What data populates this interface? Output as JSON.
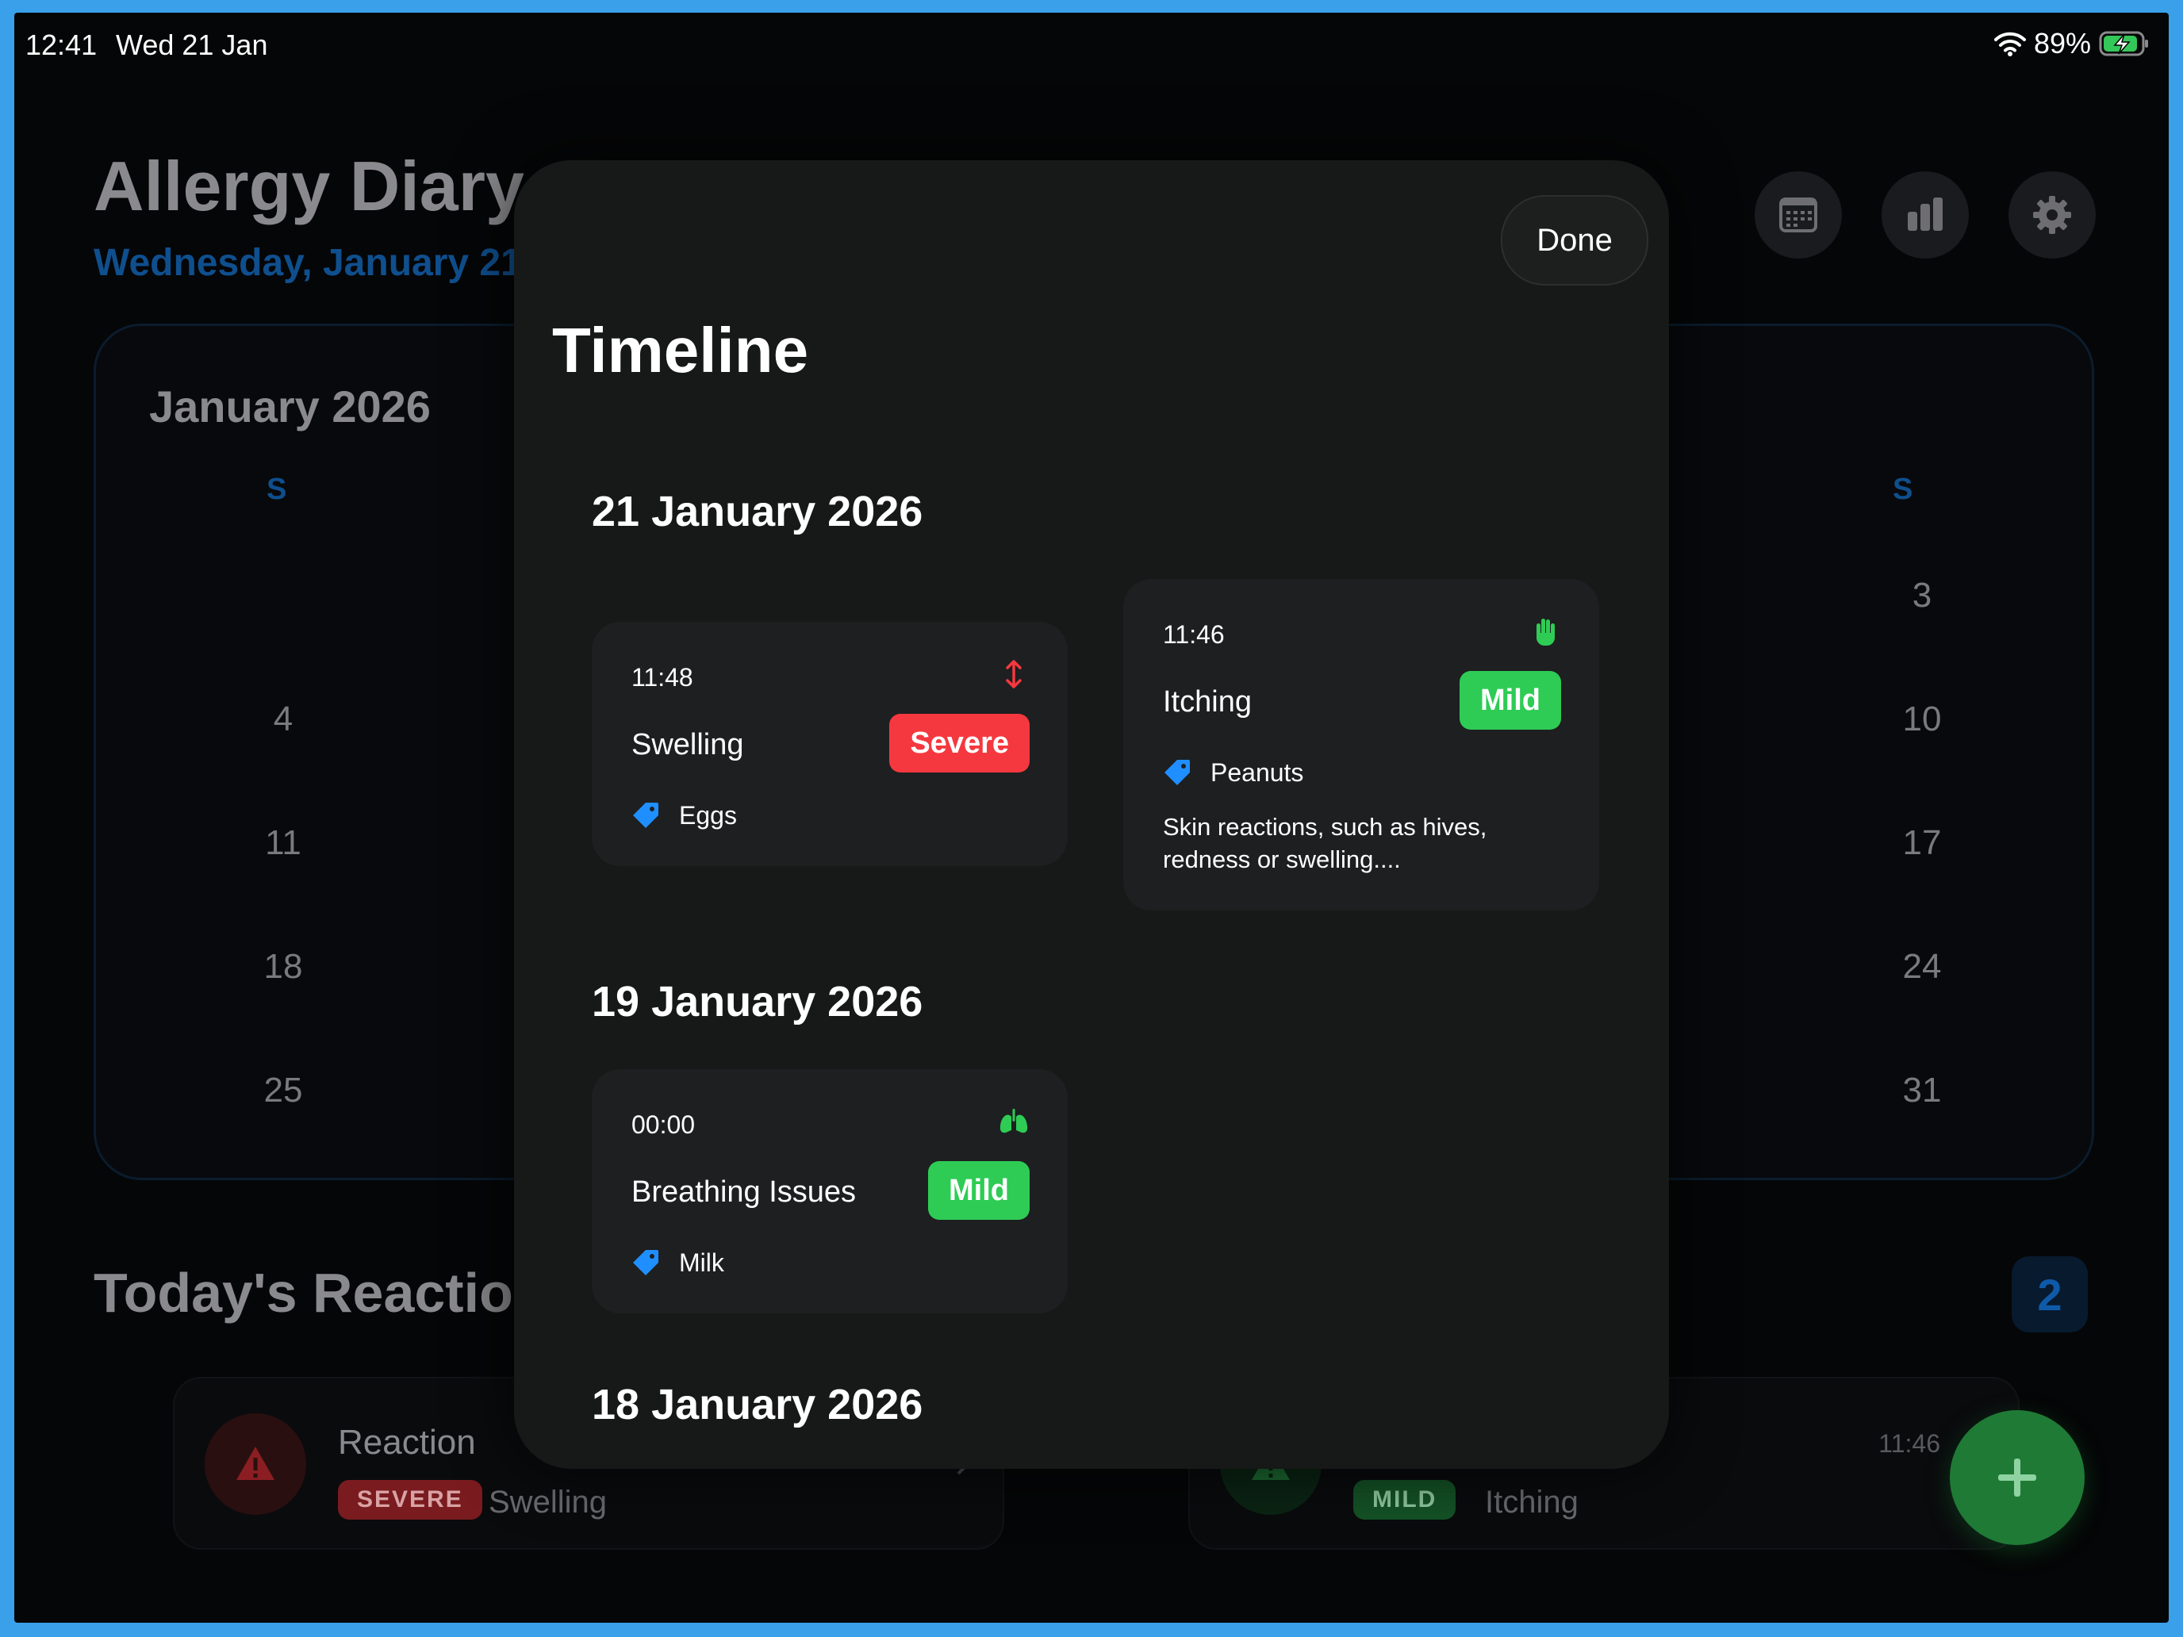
{
  "status_bar": {
    "time": "12:41",
    "date": "Wed 21 Jan",
    "battery": "89%"
  },
  "background": {
    "title": "Allergy Diary",
    "subtitle": "Wednesday, January 21",
    "calendar": {
      "month": "January 2026",
      "weekday_left": "S",
      "weekday_right": "S",
      "left_days": [
        "4",
        "11",
        "18",
        "25"
      ],
      "right_days": [
        "3",
        "10",
        "17",
        "24",
        "31"
      ]
    },
    "section_title": "Today's Reactions",
    "reaction_count": "2",
    "reactions": [
      {
        "title": "Reaction",
        "severity": "SEVERE",
        "symptom": "Swelling"
      },
      {
        "time": "11:46",
        "severity": "MILD",
        "symptom": "Itching"
      }
    ]
  },
  "modal": {
    "done_label": "Done",
    "title": "Timeline",
    "days": [
      {
        "date": "21 January 2026",
        "entries": [
          {
            "time": "11:48",
            "symptom": "Swelling",
            "severity": "Severe",
            "allergen": "Eggs",
            "icon": "swelling-arrows-icon"
          },
          {
            "time": "11:46",
            "symptom": "Itching",
            "severity": "Mild",
            "allergen": "Peanuts",
            "icon": "hand-icon",
            "note": "Skin reactions, such as hives, redness or swelling...."
          }
        ]
      },
      {
        "date": "19 January 2026",
        "entries": [
          {
            "time": "00:00",
            "symptom": "Breathing Issues",
            "severity": "Mild",
            "allergen": "Milk",
            "icon": "lungs-icon"
          }
        ]
      },
      {
        "date": "18 January 2026",
        "entries": []
      }
    ]
  },
  "colors": {
    "severe": "#f5383f",
    "mild": "#2ecc55",
    "accent": "#1f8fff",
    "modal_bg": "#161917",
    "card_bg": "#1e1f21"
  }
}
